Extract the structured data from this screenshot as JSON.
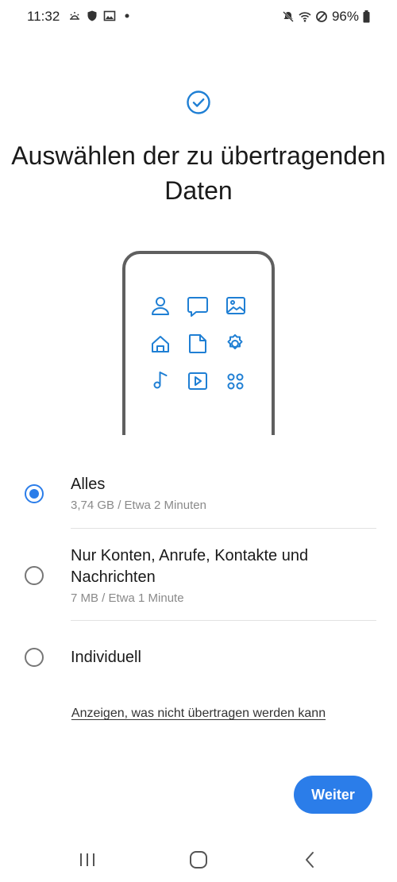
{
  "status_bar": {
    "time": "11:32",
    "battery": "96%",
    "left_icons": [
      "weather-icon",
      "shield-icon",
      "image-icon",
      "dot-icon"
    ],
    "right_icons": [
      "mute-icon",
      "wifi-icon",
      "block-icon",
      "battery-icon"
    ]
  },
  "header": {
    "icon": "check-circle-icon",
    "title": "Auswählen der zu übertragenden Daten"
  },
  "illustration": {
    "icons": [
      "person-icon",
      "message-icon",
      "image-icon",
      "home-icon",
      "document-icon",
      "settings-icon",
      "music-icon",
      "video-icon",
      "apps-icon"
    ]
  },
  "options": [
    {
      "label": "Alles",
      "sub": "3,74 GB / Etwa 2 Minuten",
      "selected": true
    },
    {
      "label": "Nur Konten, Anrufe, Kontakte und Nachrichten",
      "sub": "7 MB / Etwa 1 Minute",
      "selected": false
    },
    {
      "label": "Individuell",
      "sub": "",
      "selected": false
    }
  ],
  "link_text": "Anzeigen, was nicht übertragen werden kann",
  "next_label": "Weiter",
  "colors": {
    "accent": "#2b7de9",
    "icon_blue": "#1f7fd4",
    "frame": "#5f5f5f"
  },
  "nav": [
    "recent-apps-icon",
    "home-button-icon",
    "back-icon"
  ]
}
